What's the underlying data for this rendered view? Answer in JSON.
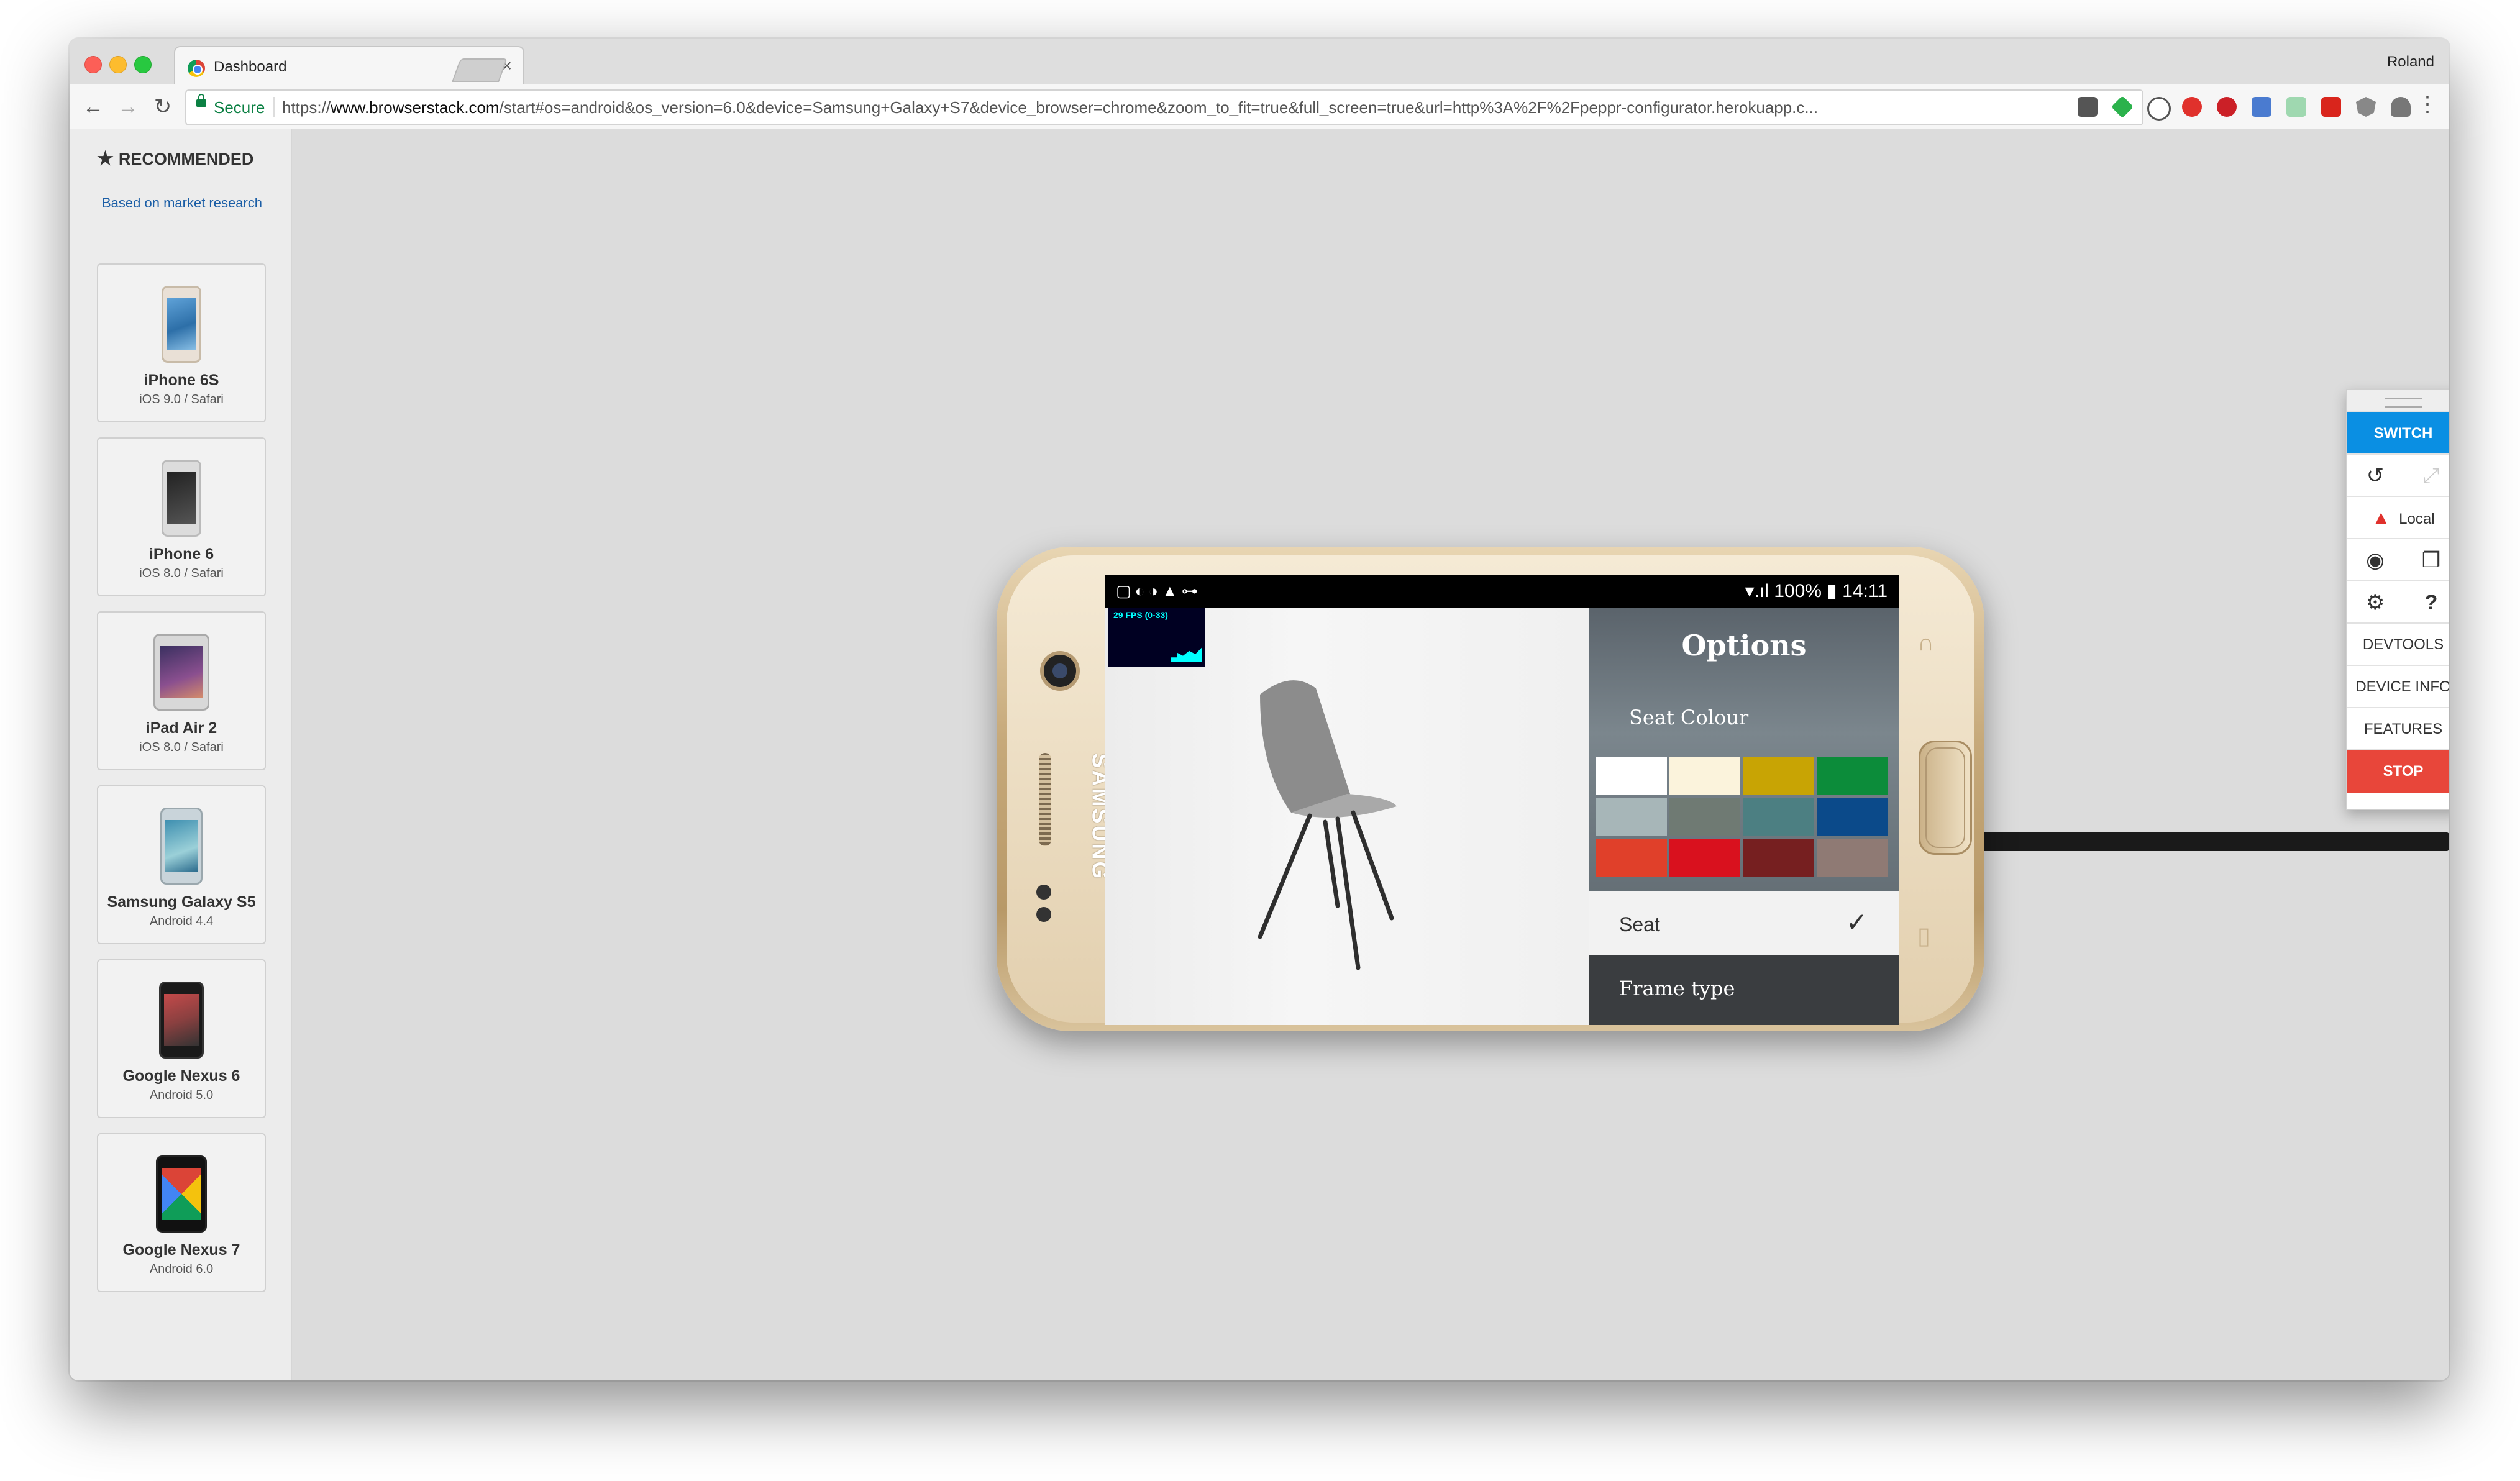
{
  "browser": {
    "tab_title": "Dashboard",
    "tab_close": "×",
    "profile": "Roland",
    "secure_label": "Secure",
    "url_scheme": "https://",
    "url_host": "www.browserstack.com",
    "url_rest": "/start#os=android&os_version=6.0&device=Samsung+Galaxy+S7&device_browser=chrome&zoom_to_fit=true&full_screen=true&url=http%3A%2F%2Fpeppr-configurator.herokuapp.c...",
    "back": "←",
    "forward": "→",
    "reload": "↻",
    "star": "☆",
    "menu": "⋮",
    "extensions": [
      "pocket-icon",
      "feedly-icon",
      "info-icon",
      "adblock-icon",
      "pinterest-icon",
      "badge-ext-icon",
      "grid-ext-icon",
      "cors-icon",
      "shield-ext-icon",
      "cloud-ext-icon"
    ]
  },
  "sidebar": {
    "heading": "RECOMMENDED",
    "heading_icon": "★",
    "subheading": "Based on market research",
    "devices": [
      {
        "name": "iPhone 6S",
        "sub": "iOS 9.0  /  Safari"
      },
      {
        "name": "iPhone 6",
        "sub": "iOS 8.0  /  Safari"
      },
      {
        "name": "iPad Air 2",
        "sub": "iOS 8.0  /  Safari"
      },
      {
        "name": "Samsung Galaxy S5",
        "sub": "Android 4.4"
      },
      {
        "name": "Google Nexus 6",
        "sub": "Android 5.0"
      },
      {
        "name": "Google Nexus 7",
        "sub": "Android 6.0"
      }
    ]
  },
  "device": {
    "brand": "SAMSUNG",
    "status_icons": "▢◐◑▲⊶",
    "status_right": "▾.ıl 100% ▮ 14:11",
    "fps": "29 FPS (0-33)",
    "options_title": "Options",
    "seat_colour": "Seat Colour",
    "swatches": [
      "#ffffff",
      "#fbf3dc",
      "#c8a404",
      "#0c8c3a",
      "#a7b6b8",
      "#6f7a73",
      "#4c7f82",
      "#0b4a8a",
      "#e0402a",
      "#d9111e",
      "#761f20",
      "#8f7a74"
    ],
    "seat_label": "Seat",
    "seat_check": "✓",
    "frame_label": "Frame type"
  },
  "floating_toolbar": {
    "switch": "SWITCH",
    "rotate": "↺",
    "fullscreen": "⤢",
    "warn_icon": "▲",
    "local": "Local",
    "camera": "◉",
    "windows": "❐",
    "gear": "⚙",
    "help": "?",
    "devtools": "DEVTOOLS",
    "device_info": "DEVICE INFO",
    "features": "FEATURES",
    "stop": "STOP"
  }
}
